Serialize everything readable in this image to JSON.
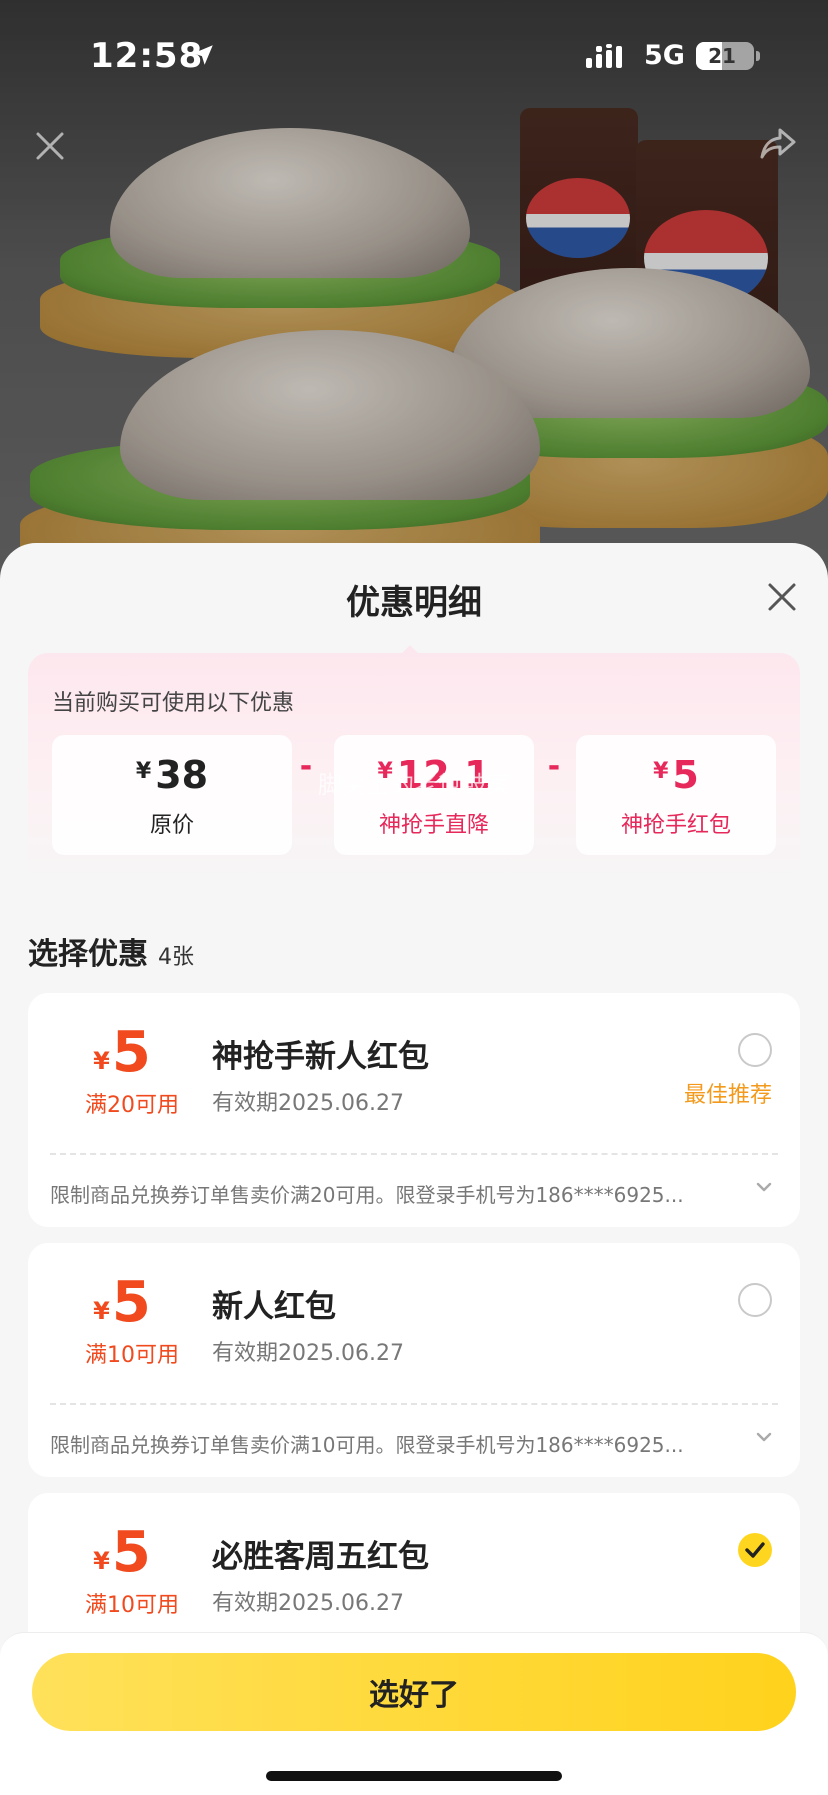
{
  "status_bar": {
    "time": "12:58",
    "network": "5G",
    "battery": "21"
  },
  "sheet": {
    "title": "优惠明细",
    "summary": {
      "intro": "当前购买可使用以下优惠",
      "currency": "¥",
      "original": {
        "value": "38",
        "label": "原价"
      },
      "minus": "-",
      "direct_discount": {
        "value": "12.1",
        "label": "神抢手直降"
      },
      "red_packet": {
        "value": "5",
        "label": "神抢手红包"
      }
    },
    "watermark": "脚尖上的老愆鼓案",
    "select": {
      "title": "选择优惠",
      "count": "4张"
    },
    "coupons": [
      {
        "currency": "¥",
        "amount": "5",
        "condition": "满20可用",
        "name": "神抢手新人红包",
        "validity": "有效期2025.06.27",
        "badge": "最佳推荐",
        "checked": false,
        "description": "限制商品兑换券订单售卖价满20可用。限登录手机号为186****6925..."
      },
      {
        "currency": "¥",
        "amount": "5",
        "condition": "满10可用",
        "name": "新人红包",
        "validity": "有效期2025.06.27",
        "checked": false,
        "description": "限制商品兑换券订单售卖价满10可用。限登录手机号为186****6925..."
      },
      {
        "currency": "¥",
        "amount": "5",
        "condition": "满10可用",
        "name": "必胜客周五红包",
        "validity": "有效期2025.06.27",
        "checked": true
      }
    ],
    "confirm_label": "选好了"
  },
  "colors": {
    "accent_red": "#f04a1e",
    "accent_pink": "#e6285a",
    "best_orange": "#f39a1c",
    "confirm_yellow": "#ffd21c"
  },
  "icons": [
    "location-arrow-icon",
    "signal-icon",
    "close-icon",
    "share-icon",
    "chevron-down-icon",
    "checkmark-icon"
  ]
}
